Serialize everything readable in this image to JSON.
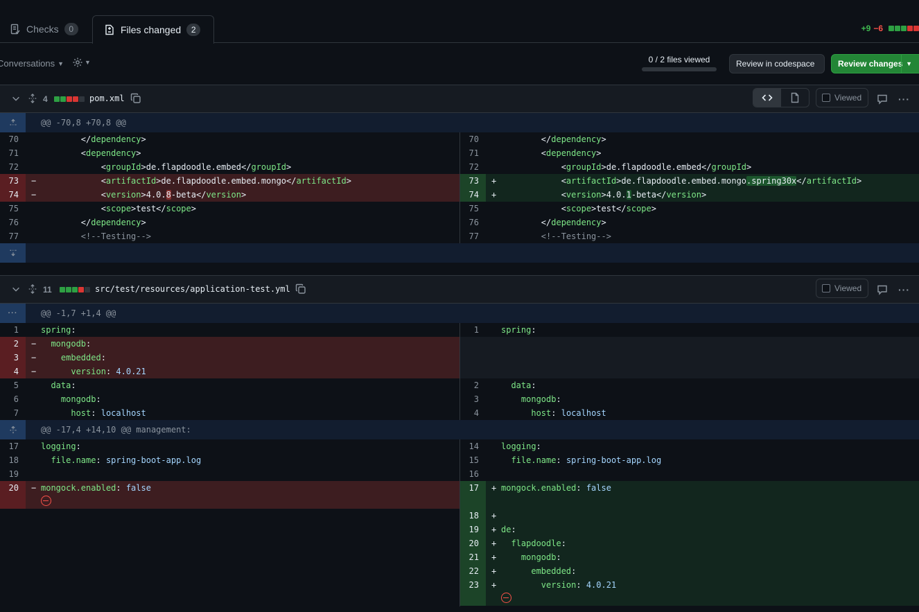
{
  "tabs": {
    "checks_label": "Checks",
    "checks_count": "0",
    "files_label": "Files changed",
    "files_count": "2"
  },
  "summary": {
    "additions": "+9",
    "deletions": "−6"
  },
  "toolbar": {
    "conversations_label": "Conversations",
    "files_viewed": "0 / 2 files viewed",
    "files_viewed_fraction": 0,
    "codespace_label": "Review in codespace",
    "review_label": "Review changes",
    "viewed_label": "Viewed"
  },
  "files": [
    {
      "count": "4",
      "name": "pom.xml",
      "hunk": "@@ -70,8 +70,8 @@"
    },
    {
      "count": "11",
      "name": "src/test/resources/application-test.yml",
      "hunk1": "@@ -1,7 +1,4 @@",
      "hunk2": "@@ -17,4 +14,10 @@ management:"
    }
  ],
  "colors": {
    "added": "#2ea043",
    "deleted": "#da3633",
    "accent": "#238636"
  }
}
